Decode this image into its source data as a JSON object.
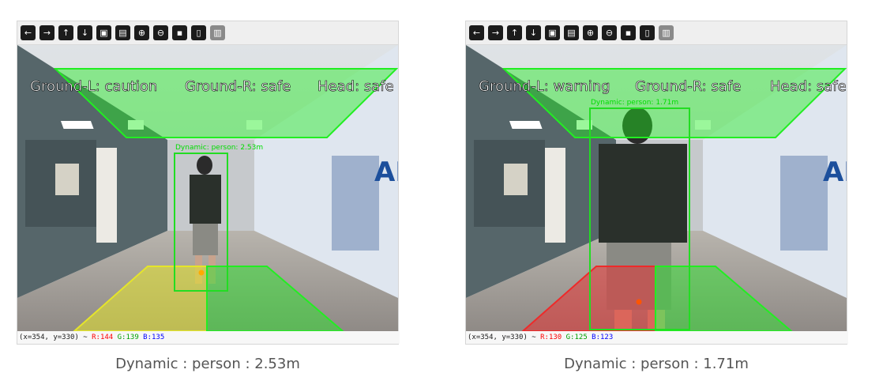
{
  "toolbar_icons": [
    {
      "name": "arrow-left-icon",
      "glyph": "←"
    },
    {
      "name": "arrow-right-icon",
      "glyph": "→"
    },
    {
      "name": "arrow-up-icon",
      "glyph": "↑"
    },
    {
      "name": "arrow-down-icon",
      "glyph": "↓"
    },
    {
      "name": "image-icon",
      "glyph": "▣"
    },
    {
      "name": "image-settings-icon",
      "glyph": "▤"
    },
    {
      "name": "zoom-in-icon",
      "glyph": "⊕"
    },
    {
      "name": "zoom-out-icon",
      "glyph": "⊖"
    },
    {
      "name": "save-icon",
      "glyph": "▪"
    },
    {
      "name": "clipboard-icon",
      "glyph": "▯"
    },
    {
      "name": "properties-icon",
      "glyph": "▥"
    }
  ],
  "panels": [
    {
      "overlay_text": {
        "ground_left": "Ground-L: caution",
        "ground_right": "Ground-R: safe",
        "head": "Head: safe"
      },
      "box_label": "Dynamic: person: 2.53m",
      "status": {
        "coords": "(x=354, y=330) ~ ",
        "r": "R:144",
        "g": "G:139",
        "b": "B:135"
      },
      "caption": "Dynamic : person : 2.53m"
    },
    {
      "overlay_text": {
        "ground_left": "Ground-L: warning",
        "ground_right": "Ground-R: safe",
        "head": "Head: safe"
      },
      "box_label": "Dynamic: person: 1.71m",
      "status": {
        "coords": "(x=354, y=330) ~ ",
        "r": "R:130",
        "g": "G:125",
        "b": "B:123"
      },
      "caption": "Dynamic : person : 1.71m"
    }
  ],
  "colors": {
    "zone_safe": "#22ee22",
    "zone_caution": "#e5e52a",
    "zone_warning": "#ee2a2a",
    "box_stroke": "#22dd22"
  }
}
